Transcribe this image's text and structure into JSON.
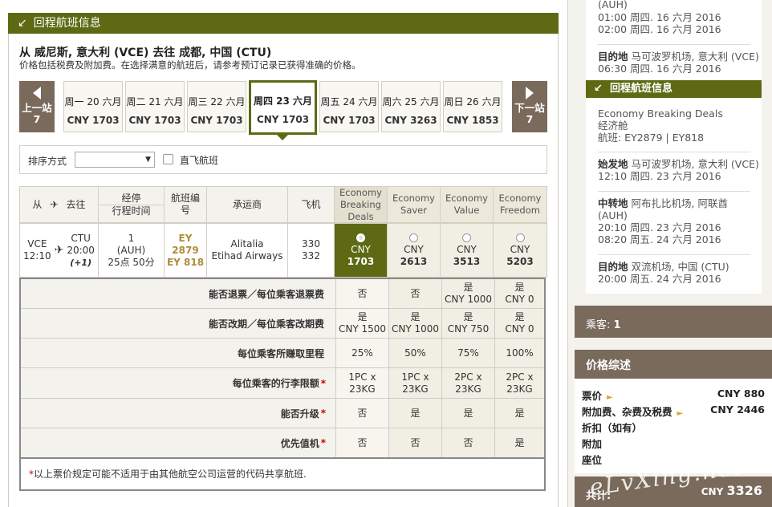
{
  "main": {
    "section_title": "回程航班信息",
    "route": "从 威尼斯, 意大利 (VCE) 去往 成都, 中国 (CTU)",
    "note": "价格包括税费及附加费。在选择满意的航班后，请参考预订记录已获得准确的价格。",
    "prev": {
      "label": "上一站",
      "num": "7"
    },
    "next": {
      "label": "下一站",
      "num": "7"
    },
    "days": [
      {
        "date": "周一 20 六月",
        "price": "CNY 1703"
      },
      {
        "date": "周二 21 六月",
        "price": "CNY 1703"
      },
      {
        "date": "周三 22 六月",
        "price": "CNY 1703"
      },
      {
        "date": "周四 23 六月",
        "price": "CNY 1703"
      },
      {
        "date": "周五 24 六月",
        "price": "CNY 1703"
      },
      {
        "date": "周六 25 六月",
        "price": "CNY 3263"
      },
      {
        "date": "周日 26 六月",
        "price": "CNY 1853"
      }
    ],
    "sort_label": "排序方式",
    "sort_value": "",
    "direct_label": "直飞航班",
    "headers": {
      "from": "从",
      "to": "去往",
      "via": "经停",
      "duration": "行程时间",
      "flight_no": "航班编号",
      "carrier": "承运商",
      "aircraft": "飞机",
      "fares": [
        "Economy Breaking Deals",
        "Economy Saver",
        "Economy Value",
        "Economy Freedom"
      ]
    },
    "flight": {
      "from_code": "VCE",
      "from_time": "12:10",
      "to_code": "CTU",
      "to_time": "20:00",
      "to_plus": "(+1)",
      "stops": "1",
      "stop_code": "(AUH)",
      "duration": "25点 50分",
      "flight1": "EY 2879",
      "flight2": "EY 818",
      "carrier1": "Alitalia",
      "carrier2": "Etihad Airways",
      "ac1": "330",
      "ac2": "332",
      "fares": [
        {
          "cur": "CNY",
          "amt": "1703"
        },
        {
          "cur": "CNY",
          "amt": "2613"
        },
        {
          "cur": "CNY",
          "amt": "3513"
        },
        {
          "cur": "CNY",
          "amt": "5203"
        }
      ]
    },
    "compare_rows": [
      {
        "label": "能否退票／每位乘客退票费",
        "star": "",
        "vals": [
          [
            "否"
          ],
          [
            "否"
          ],
          [
            "是",
            "CNY 1000"
          ],
          [
            "是",
            "CNY 0"
          ]
        ]
      },
      {
        "label": "能否改期／每位乘客改期费",
        "star": "",
        "vals": [
          [
            "是",
            "CNY 1500"
          ],
          [
            "是",
            "CNY 1000"
          ],
          [
            "是",
            "CNY 750"
          ],
          [
            "是",
            "CNY 0"
          ]
        ]
      },
      {
        "label": "每位乘客所赚取里程",
        "star": "",
        "vals": [
          [
            "25%"
          ],
          [
            "50%"
          ],
          [
            "75%"
          ],
          [
            "100%"
          ]
        ]
      },
      {
        "label": "每位乘客的行李限额",
        "star": "*",
        "vals": [
          [
            "1PC x",
            "23KG"
          ],
          [
            "1PC x",
            "23KG"
          ],
          [
            "2PC x",
            "23KG"
          ],
          [
            "2PC x",
            "23KG"
          ]
        ]
      },
      {
        "label": "能否升级",
        "star": "*",
        "vals": [
          [
            "否"
          ],
          [
            "是"
          ],
          [
            "是"
          ],
          [
            "是"
          ]
        ]
      },
      {
        "label": "优先值机",
        "star": "*",
        "vals": [
          [
            "否"
          ],
          [
            "否"
          ],
          [
            "否"
          ],
          [
            "是"
          ]
        ]
      }
    ],
    "footnote_star": "*",
    "footnote": "以上票价规定可能不适用于由其他航空公司运营的代码共享航班."
  },
  "side": {
    "top": {
      "line1": "(AUH)",
      "line2": "01:00 周四. 16 六月 2016",
      "line3": "02:00 周四. 16 六月 2016"
    },
    "dest1": {
      "label": "目的地",
      "place": "马可波罗机场, 意大利 (VCE)",
      "time": "06:30 周四. 16 六月 2016"
    },
    "return_title": "回程航班信息",
    "fare_name": "Economy Breaking Deals",
    "cabin": "经济舱",
    "flights": "航班:  EY2879 | EY818",
    "origin": {
      "label": "始发地",
      "place": "马可波罗机场, 意大利 (VCE)",
      "time": "12:10 周四. 23 六月 2016"
    },
    "transit": {
      "label": "中转地",
      "place": "阿布扎比机场, 阿联酋",
      "code": "(AUH)",
      "t1": "20:10 周四. 23 六月 2016",
      "t2": "08:20 周五. 24 六月 2016"
    },
    "dest2": {
      "label": "目的地",
      "place": "双流机场, 中国 (CTU)",
      "time": "20:00 周五. 24 六月 2016"
    },
    "pax_label": "乘客:",
    "pax_count": "1",
    "price_title": "价格综述",
    "price_rows": [
      {
        "label": "票价",
        "tri": "►",
        "amount": "CNY 880"
      },
      {
        "label": "附加费、杂费及税费",
        "tri": "►",
        "amount": "CNY 2446"
      },
      {
        "label": "折扣（如有）",
        "tri": "",
        "amount": ""
      },
      {
        "label": "附加",
        "tri": "",
        "amount": ""
      },
      {
        "label": "座位",
        "tri": "",
        "amount": ""
      }
    ],
    "total_label": "共计:",
    "total_cur": "CNY",
    "total_amt": "3326"
  },
  "watermark": "eLvXing.net",
  "colors": {
    "accent": "#5d6a13",
    "brown": "#7a6a5c",
    "flight_no": "#b08c3c"
  }
}
